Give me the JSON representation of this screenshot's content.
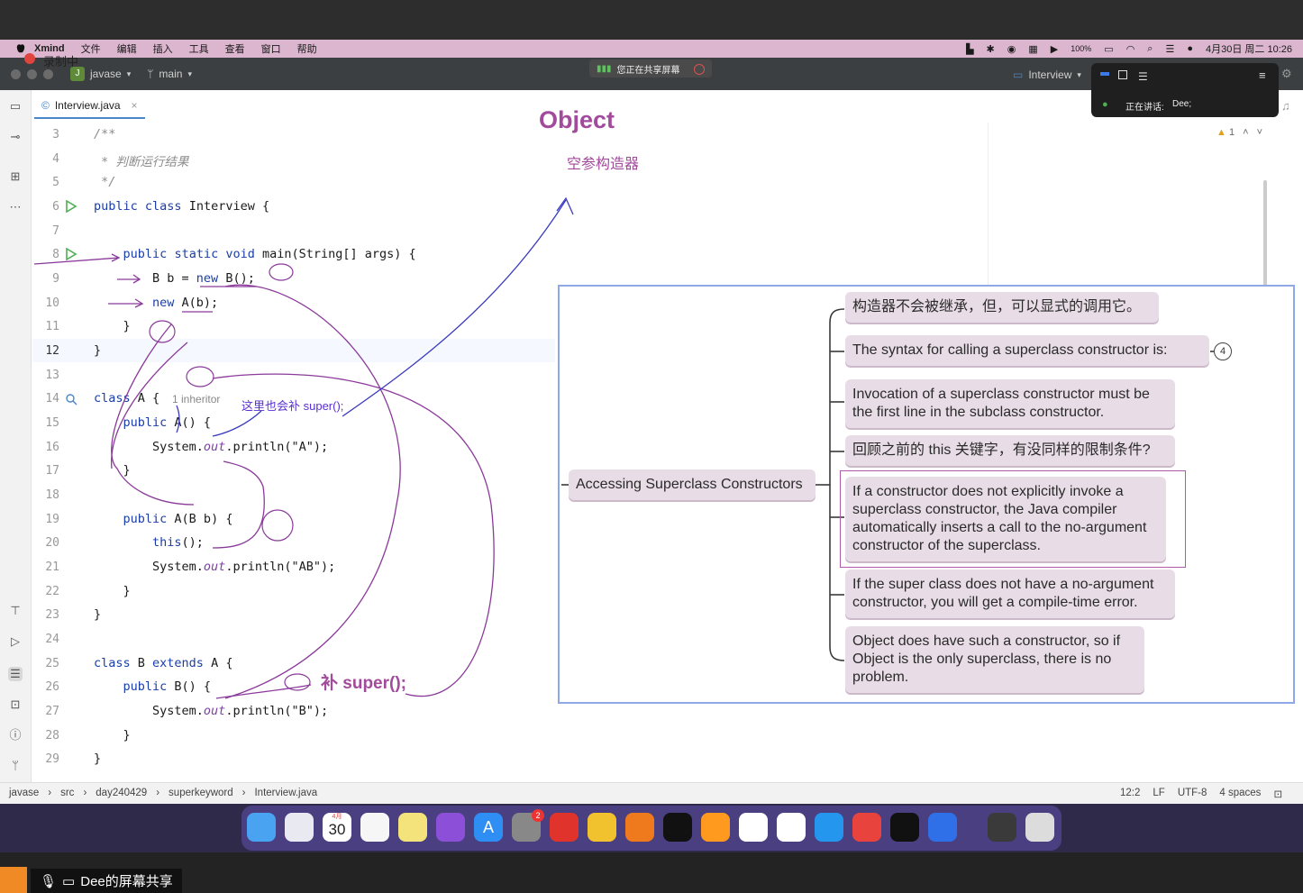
{
  "menubar": {
    "app_name": "Xmind",
    "items": [
      "文件",
      "编辑",
      "插入",
      "工具",
      "查看",
      "窗口",
      "帮助"
    ],
    "battery": "100%",
    "datetime": "4月30日 周二  10:26"
  },
  "recording": {
    "label": "录制中"
  },
  "titlebar": {
    "project_badge": "J",
    "project": "javase",
    "branch": "main",
    "share_banner": "您正在共享屏幕",
    "run_config": "Interview"
  },
  "meeting": {
    "speaking_label": "正在讲话:",
    "speaker": "Dee;"
  },
  "editor": {
    "tab_name": "Interview.java",
    "warning_count": "1",
    "inheritor_hint": "1 inheritor",
    "lines": [
      {
        "n": "3",
        "text": "/**"
      },
      {
        "n": "4",
        "text": " * 判断运行结果"
      },
      {
        "n": "5",
        "text": " */"
      },
      {
        "n": "6",
        "text": "public class Interview {"
      },
      {
        "n": "7",
        "text": ""
      },
      {
        "n": "8",
        "text": "    public static void main(String[] args) {"
      },
      {
        "n": "9",
        "text": "        B b = new B();"
      },
      {
        "n": "10",
        "text": "        new A(b);"
      },
      {
        "n": "11",
        "text": "    }"
      },
      {
        "n": "12",
        "text": "}"
      },
      {
        "n": "13",
        "text": ""
      },
      {
        "n": "14",
        "text": "class A {"
      },
      {
        "n": "15",
        "text": "    public A() {"
      },
      {
        "n": "16",
        "text": "        System.out.println(\"A\");"
      },
      {
        "n": "17",
        "text": "    }"
      },
      {
        "n": "18",
        "text": ""
      },
      {
        "n": "19",
        "text": "    public A(B b) {"
      },
      {
        "n": "20",
        "text": "        this();"
      },
      {
        "n": "21",
        "text": "        System.out.println(\"AB\");"
      },
      {
        "n": "22",
        "text": "    }"
      },
      {
        "n": "23",
        "text": "}"
      },
      {
        "n": "24",
        "text": ""
      },
      {
        "n": "25",
        "text": "class B extends A {"
      },
      {
        "n": "26",
        "text": "    public B() {"
      },
      {
        "n": "27",
        "text": "        System.out.println(\"B\");"
      },
      {
        "n": "28",
        "text": "    }"
      },
      {
        "n": "29",
        "text": "}"
      }
    ]
  },
  "annotations": {
    "object_title": "Object",
    "object_sub": "空参构造器",
    "super_note": "这里也会补 super();",
    "bu_super": "补 super();",
    "circled": [
      "1",
      "2",
      "3",
      "4",
      "5"
    ]
  },
  "mindmap": {
    "central": "Accessing Superclass Constructors",
    "badge": "4",
    "nodes": [
      "构造器不会被继承，但，可以显式的调用它。",
      "The syntax for calling a superclass constructor is:",
      "Invocation of a superclass constructor must be the first line in the subclass constructor.",
      "回顾之前的 this 关键字，有没同样的限制条件?",
      "If a constructor does not explicitly invoke a superclass constructor, the Java compiler automatically inserts a call to the no-argument constructor of the superclass.",
      "If the super class does not have a no-argument constructor, you will get a compile-time error.",
      "Object does have such a constructor, so if Object is the only superclass, there is no problem."
    ]
  },
  "statusbar": {
    "breadcrumb": [
      "javase",
      "src",
      "day240429",
      "superkeyword",
      "Interview.java"
    ],
    "position": "12:2",
    "line_sep": "LF",
    "encoding": "UTF-8",
    "indent": "4 spaces"
  },
  "dock": {
    "calendar_month": "4月",
    "calendar_day": "30",
    "settings_badge": "2"
  },
  "bottom": {
    "share_label": "Dee的屏幕共享"
  },
  "colors": {
    "accent": "#a24a9c",
    "ink": "#5a2fd0",
    "dock": "#4a3f80",
    "menubar": "#dcb6cf"
  }
}
